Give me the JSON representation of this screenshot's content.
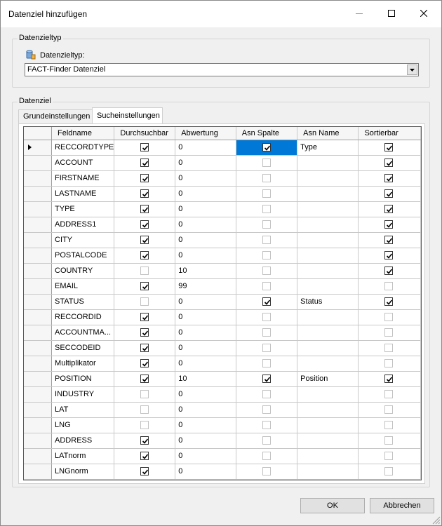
{
  "window": {
    "title": "Datenziel hinzufügen"
  },
  "target_type_group": {
    "legend": "Datenzieltyp",
    "label": "Datenzieltyp:",
    "combo_value": "FACT-Finder Datenziel"
  },
  "target_group": {
    "legend": "Datenziel"
  },
  "tabs": [
    "Grundeinstellungen",
    "Sucheinstellungen"
  ],
  "active_tab": "Sucheinstellungen",
  "grid": {
    "columns": [
      "Feldname",
      "Durchsuchbar",
      "Abwertung",
      "Asn Spalte",
      "Asn Name",
      "Sortierbar"
    ],
    "rows": [
      {
        "name": "RECCORDTYPE",
        "durchsuchbar": true,
        "abwertung": "0",
        "asn_spalte": true,
        "asn_name": "Type",
        "sortierbar": true
      },
      {
        "name": "ACCOUNT",
        "durchsuchbar": true,
        "abwertung": "0",
        "asn_spalte": false,
        "asn_name": "",
        "sortierbar": true
      },
      {
        "name": "FIRSTNAME",
        "durchsuchbar": true,
        "abwertung": "0",
        "asn_spalte": false,
        "asn_name": "",
        "sortierbar": true
      },
      {
        "name": "LASTNAME",
        "durchsuchbar": true,
        "abwertung": "0",
        "asn_spalte": false,
        "asn_name": "",
        "sortierbar": true
      },
      {
        "name": "TYPE",
        "durchsuchbar": true,
        "abwertung": "0",
        "asn_spalte": false,
        "asn_name": "",
        "sortierbar": true
      },
      {
        "name": "ADDRESS1",
        "durchsuchbar": true,
        "abwertung": "0",
        "asn_spalte": false,
        "asn_name": "",
        "sortierbar": true
      },
      {
        "name": "CITY",
        "durchsuchbar": true,
        "abwertung": "0",
        "asn_spalte": false,
        "asn_name": "",
        "sortierbar": true
      },
      {
        "name": "POSTALCODE",
        "durchsuchbar": true,
        "abwertung": "0",
        "asn_spalte": false,
        "asn_name": "",
        "sortierbar": true
      },
      {
        "name": "COUNTRY",
        "durchsuchbar": false,
        "abwertung": "10",
        "asn_spalte": false,
        "asn_name": "",
        "sortierbar": true
      },
      {
        "name": "EMAIL",
        "durchsuchbar": true,
        "abwertung": "99",
        "asn_spalte": false,
        "asn_name": "",
        "sortierbar": false
      },
      {
        "name": "STATUS",
        "durchsuchbar": false,
        "abwertung": "0",
        "asn_spalte": true,
        "asn_name": "Status",
        "sortierbar": true
      },
      {
        "name": "RECCORDID",
        "durchsuchbar": true,
        "abwertung": "0",
        "asn_spalte": false,
        "asn_name": "",
        "sortierbar": false
      },
      {
        "name": "ACCOUNTMA...",
        "durchsuchbar": true,
        "abwertung": "0",
        "asn_spalte": false,
        "asn_name": "",
        "sortierbar": false
      },
      {
        "name": "SECCODEID",
        "durchsuchbar": true,
        "abwertung": "0",
        "asn_spalte": false,
        "asn_name": "",
        "sortierbar": false
      },
      {
        "name": "Multiplikator",
        "durchsuchbar": true,
        "abwertung": "0",
        "asn_spalte": false,
        "asn_name": "",
        "sortierbar": false
      },
      {
        "name": "POSITION",
        "durchsuchbar": true,
        "abwertung": "10",
        "asn_spalte": true,
        "asn_name": "Position",
        "sortierbar": true
      },
      {
        "name": "INDUSTRY",
        "durchsuchbar": false,
        "abwertung": "0",
        "asn_spalte": false,
        "asn_name": "",
        "sortierbar": false
      },
      {
        "name": "LAT",
        "durchsuchbar": false,
        "abwertung": "0",
        "asn_spalte": false,
        "asn_name": "",
        "sortierbar": false
      },
      {
        "name": "LNG",
        "durchsuchbar": false,
        "abwertung": "0",
        "asn_spalte": false,
        "asn_name": "",
        "sortierbar": false
      },
      {
        "name": "ADDRESS",
        "durchsuchbar": true,
        "abwertung": "0",
        "asn_spalte": false,
        "asn_name": "",
        "sortierbar": false
      },
      {
        "name": "LATnorm",
        "durchsuchbar": true,
        "abwertung": "0",
        "asn_spalte": false,
        "asn_name": "",
        "sortierbar": false
      },
      {
        "name": "LNGnorm",
        "durchsuchbar": true,
        "abwertung": "0",
        "asn_spalte": false,
        "asn_name": "",
        "sortierbar": false
      }
    ]
  },
  "buttons": {
    "ok": "OK",
    "cancel": "Abbrechen"
  },
  "colors": {
    "selection": "#0078d7",
    "window_bg": "#f0f0f0"
  },
  "icons": {
    "minimize": "minimize-icon",
    "maximize": "maximize-icon",
    "close": "close-icon",
    "target_type": "database-target-icon",
    "combo_arrow": "chevron-down-icon",
    "row_indicator": "current-row-arrow-icon",
    "grip": "resize-grip-icon"
  }
}
